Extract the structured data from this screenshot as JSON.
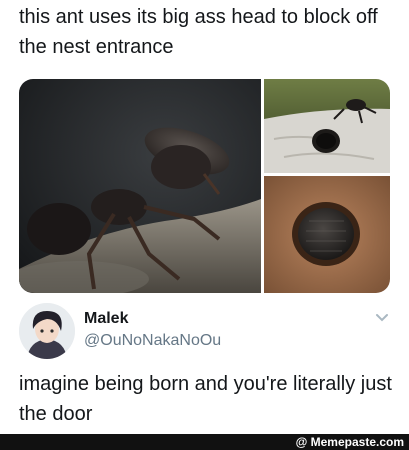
{
  "post": {
    "caption": "this ant uses its big ass head to block off the nest entrance",
    "images": [
      {
        "alt": "ant blocking entrance with head, close-up"
      },
      {
        "alt": "ant on branch next to hole"
      },
      {
        "alt": "ant head plugging hole in bark"
      }
    ]
  },
  "tweet": {
    "name": "Malek",
    "handle": "@OuNoNakaNoOu",
    "text": "imagine being born and you're literally just the door",
    "more_icon": "chevron-down-icon"
  },
  "footer": {
    "watermark": "@ Memepaste.com"
  },
  "colors": {
    "text": "#14171a",
    "handle": "#657786",
    "footer_bg": "#111111"
  }
}
